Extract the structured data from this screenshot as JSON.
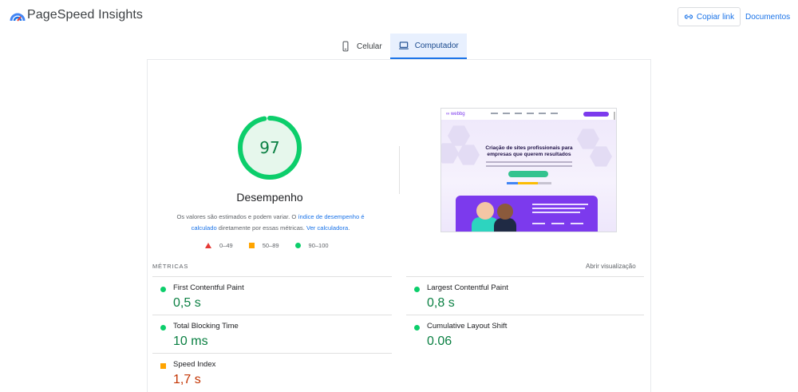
{
  "header": {
    "brand": "PageSpeed Insights",
    "copy_link": "Copiar link",
    "docs": "Documentos",
    "link_icon": "link-icon"
  },
  "tabs": [
    {
      "label": "Celular",
      "icon": "phone-icon",
      "active": false
    },
    {
      "label": "Computador",
      "icon": "laptop-icon",
      "active": true
    }
  ],
  "performance": {
    "score": "97",
    "score_fraction": 0.97,
    "title": "Desempenho",
    "note_before": "Os valores são estimados e podem variar. O ",
    "note_link1": "índice de desempenho é calculado",
    "note_middle": " diretamente por essas métricas. ",
    "note_link2": "Ver calculadora",
    "note_end": ".",
    "legend": [
      {
        "label": "0–49",
        "shape": "triangle",
        "color": "#e53935"
      },
      {
        "label": "50–89",
        "shape": "square",
        "color": "#ffa400"
      },
      {
        "label": "90–100",
        "shape": "circle",
        "color": "#0cce6b"
      }
    ],
    "gauge_color": "#0cce6b",
    "gauge_bg": "#e6f7ec"
  },
  "screenshot": {
    "logo": "∞ webbg",
    "headline": "Criação de sites profissionais para empresas que querem resultados"
  },
  "metrics": {
    "title": "MÉTRICAS",
    "expand": "Abrir visualização",
    "items": [
      {
        "name": "First Contentful Paint",
        "value": "0,5 s",
        "status": "good"
      },
      {
        "name": "Largest Contentful Paint",
        "value": "0,8 s",
        "status": "good"
      },
      {
        "name": "Total Blocking Time",
        "value": "10 ms",
        "status": "good"
      },
      {
        "name": "Cumulative Layout Shift",
        "value": "0.06",
        "status": "good"
      },
      {
        "name": "Speed Index",
        "value": "1,7 s",
        "status": "average"
      }
    ]
  }
}
